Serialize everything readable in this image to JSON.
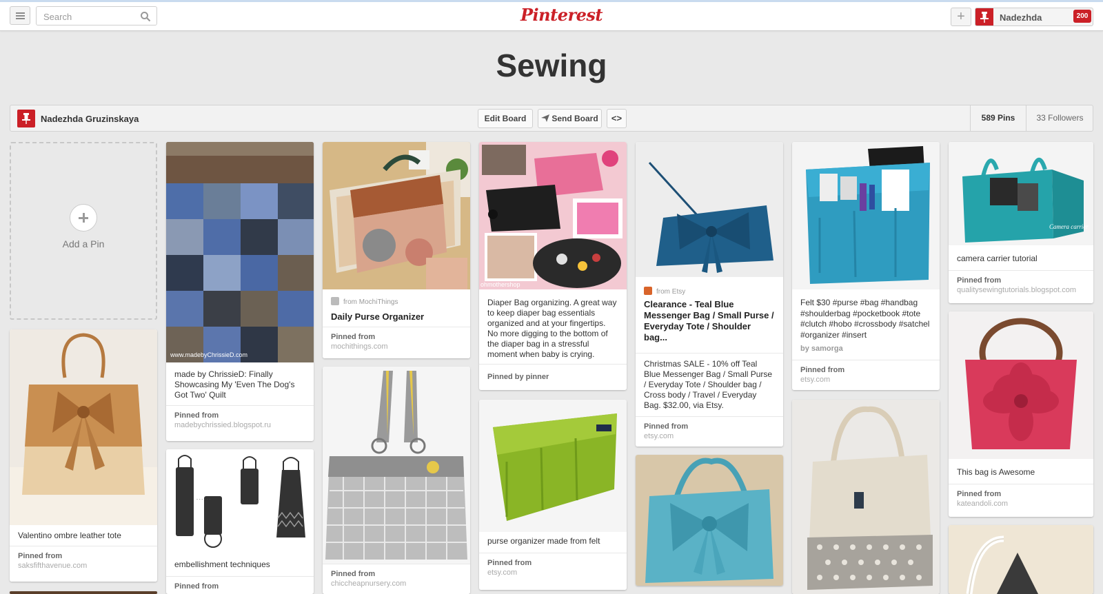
{
  "header": {
    "search_placeholder": "Search",
    "logo": "Pinterest",
    "user_name": "Nadezhda",
    "notification_count": "200"
  },
  "board": {
    "title": "Sewing",
    "owner": "Nadezhda Gruzinskaya",
    "edit_label": "Edit Board",
    "send_label": "Send Board",
    "embed_label": "<>",
    "pins_count": "589 Pins",
    "followers_count": "33 Followers"
  },
  "add_pin_label": "Add a Pin",
  "pins": [
    {
      "desc": "Valentino ombre leather tote",
      "source_label": "Pinned from",
      "source_domain": "saksfifthavenue.com"
    },
    {
      "desc": "made by ChrissieD: Finally Showcasing My 'Even The Dog's Got Two' Quilt",
      "source_label": "Pinned from",
      "source_domain": "madebychrissied.blogspot.ru",
      "watermark": "www.madebyChrissieD.com"
    },
    {
      "desc": "embellishment techniques",
      "source_label": "Pinned from",
      "source_domain": ""
    },
    {
      "from": "from MochiThings",
      "title": "Daily Purse Organizer",
      "source_label": "Pinned from",
      "source_domain": "mochithings.com"
    },
    {
      "desc": "",
      "source_label": "Pinned from",
      "source_domain": "chiccheapnursery.com"
    },
    {
      "desc": "Diaper Bag organizing. A great way to keep diaper bag essentials organized and at your fingertips. No more digging to the bottom of the diaper bag in a stressful moment when baby is crying.",
      "source_label": "Pinned by pinner",
      "watermark": "ohmothershop"
    },
    {
      "desc": "purse organizer made from felt",
      "source_label": "Pinned from",
      "source_domain": "etsy.com"
    },
    {
      "from": "from Etsy",
      "title": "Clearance - Teal Blue Messenger Bag / Small Purse / Everyday Tote / Shoulder bag...",
      "desc": "Christmas SALE - 10% off Teal Blue Messenger Bag / Small Purse / Everyday Tote / Shoulder bag / Cross body / Travel / Everyday Bag. $32.00, via Etsy.",
      "source_label": "Pinned from",
      "source_domain": "etsy.com"
    },
    {
      "desc": "Felt $30 #purse #bag #handbag #shoulderbag #pocketbook #tote #clutch #hobo #crossbody #satchel #organizer #insert",
      "by": "by samorga",
      "source_label": "Pinned from",
      "source_domain": "etsy.com"
    },
    {
      "desc": "camera carrier tutorial",
      "source_label": "Pinned from",
      "source_domain": "qualitysewingtutorials.blogspot.com",
      "watermark": "Camera carrier"
    },
    {
      "desc": "This bag is Awesome",
      "source_label": "Pinned from",
      "source_domain": "kateandoli.com"
    }
  ],
  "colors": {
    "brand_red": "#cb2027",
    "background": "#e9e9e9"
  }
}
